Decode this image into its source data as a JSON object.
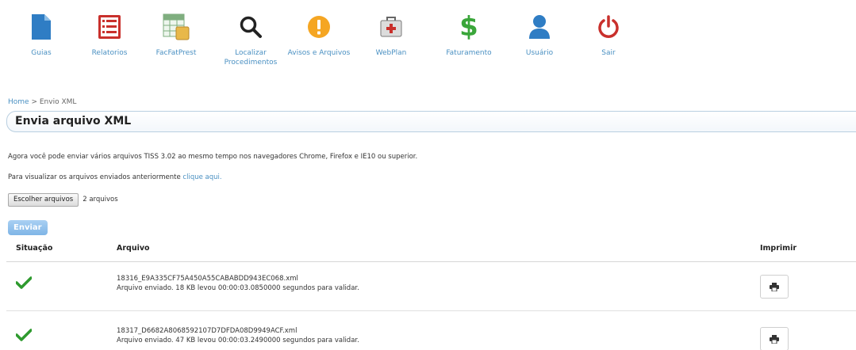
{
  "nav": {
    "guias": "Guias",
    "relatorios": "Relatorios",
    "facfatprest": "FacFatPrest",
    "localizar": "Localizar Procedimentos",
    "avisos": "Avisos e Arquivos",
    "webplan": "WebPlan",
    "faturamento": "Faturamento",
    "usuario": "Usuário",
    "sair": "Sair"
  },
  "breadcrumb": {
    "home": "Home",
    "separator": ">",
    "current": "Envio XML"
  },
  "page_title": "Envia arquivo XML",
  "info_text": "Agora você pode enviar vários arquivos TISS 3.02 ao mesmo tempo nos navegadores Chrome, Firefox e IE10 ou superior.",
  "view_text": "Para visualizar os arquivos enviados anteriormente",
  "view_link": "clique aqui.",
  "file_input": {
    "button_label": "Escolher arquivos",
    "count_label": "2 arquivos"
  },
  "send_button": "Enviar",
  "table": {
    "headers": {
      "status": "Situação",
      "file": "Arquivo",
      "print": "Imprimir"
    },
    "rows": [
      {
        "filename": "18316_E9A335CF75A450A55CABABDD943EC068.xml",
        "message": "Arquivo enviado. 18 KB levou 00:00:03.0850000 segundos para validar."
      },
      {
        "filename": "18317_D6682A8068592107D7DFDA08D9949ACF.xml",
        "message": "Arquivo enviado. 47 KB levou 00:00:03.2490000 segundos para validar."
      }
    ]
  },
  "colors": {
    "link": "#4a90c2",
    "icon_blue": "#2f7dc4",
    "icon_red": "#c9302c",
    "icon_green": "#3aa63a",
    "icon_orange": "#f5a623",
    "check_green": "#2e9a2e"
  }
}
